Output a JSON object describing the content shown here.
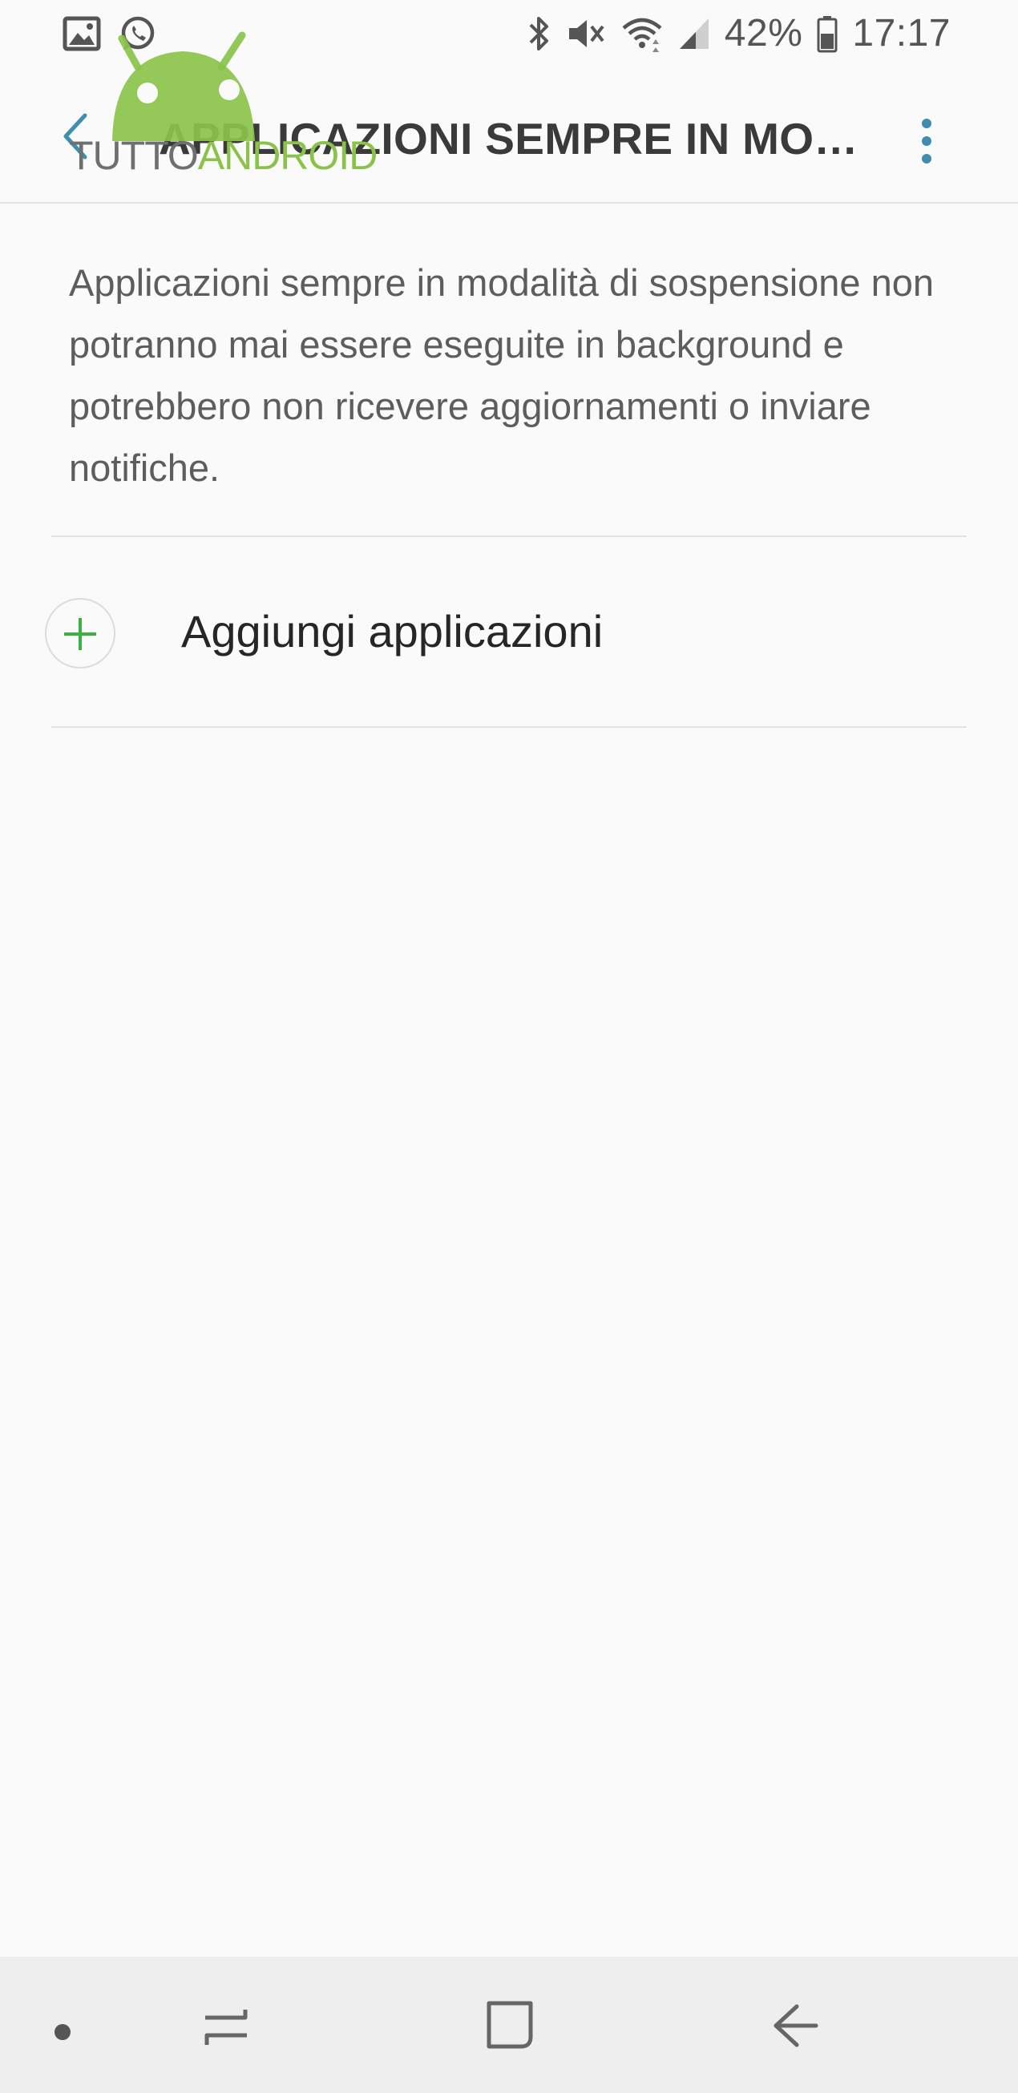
{
  "status_bar": {
    "battery_percent": "42%",
    "time": "17:17",
    "left_icons": [
      "image-notification-icon",
      "whatsapp-notification-icon"
    ],
    "right_icons": [
      "bluetooth-icon",
      "vibrate-mute-icon",
      "wifi-icon",
      "cellular-signal-icon",
      "battery-icon"
    ]
  },
  "app_bar": {
    "title": "APPLICAZIONI SEMPRE IN MODALITÀ DI SOSPENSIONE",
    "back_icon": "chevron-left-icon",
    "more_icon": "more-vert-icon",
    "accent_color": "#3f8eb0"
  },
  "watermark": {
    "text_part1": "TUTTO",
    "text_part2": "ANDROID",
    "color": "#8bc34a"
  },
  "content": {
    "description": "Applicazioni sempre in modalità di sospensione non potranno mai essere eseguite in background e potrebbero non ricevere aggiornamenti o inviare notifiche.",
    "add_label": "Aggiungi applicazioni",
    "add_icon_color": "#3cb043"
  },
  "nav_bar": {
    "buttons": [
      "dot-indicator",
      "recent-apps-icon",
      "home-icon",
      "back-arrow-icon"
    ]
  }
}
